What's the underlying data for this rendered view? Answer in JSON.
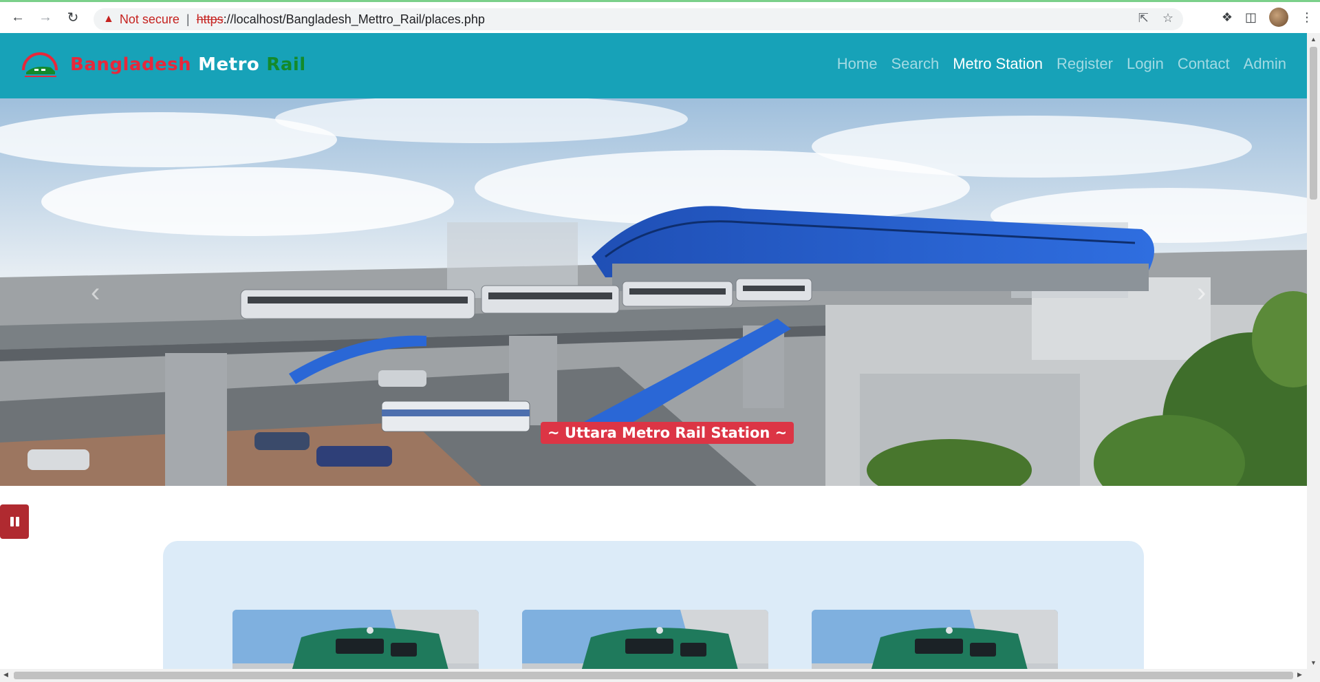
{
  "browser": {
    "security_label": "Not secure",
    "url_scheme": "https",
    "url_rest": "://localhost/Bangladesh_Mettro_Rail/places.php"
  },
  "brand": {
    "part1": "Bangladesh",
    "part2": "Metro",
    "part3": "Rail"
  },
  "nav": {
    "items": [
      {
        "label": "Home",
        "active": false
      },
      {
        "label": "Search",
        "active": false
      },
      {
        "label": "Metro Station",
        "active": true
      },
      {
        "label": "Register",
        "active": false
      },
      {
        "label": "Login",
        "active": false
      },
      {
        "label": "Contact",
        "active": false
      },
      {
        "label": "Admin",
        "active": false
      }
    ]
  },
  "hero": {
    "caption": "~ Uttara Metro Rail Station ~"
  },
  "colors": {
    "navbar": "#17a2b8",
    "caption_bg": "#dc3545",
    "pause_bg": "#b02a30",
    "panel_bg": "#dcebf8",
    "brand_red": "#e8273a",
    "brand_green": "#138a2b"
  },
  "icons": {
    "back": "arrow-left-icon",
    "forward": "arrow-right-icon",
    "reload": "reload-icon",
    "warning": "warning-triangle-icon",
    "share": "share-icon",
    "bookmark": "star-icon",
    "extensions": "puzzle-icon",
    "sidepanel": "side-panel-icon",
    "menu": "kebab-menu-icon",
    "pause": "pause-icon",
    "prev": "chevron-left-icon",
    "next": "chevron-right-icon"
  }
}
